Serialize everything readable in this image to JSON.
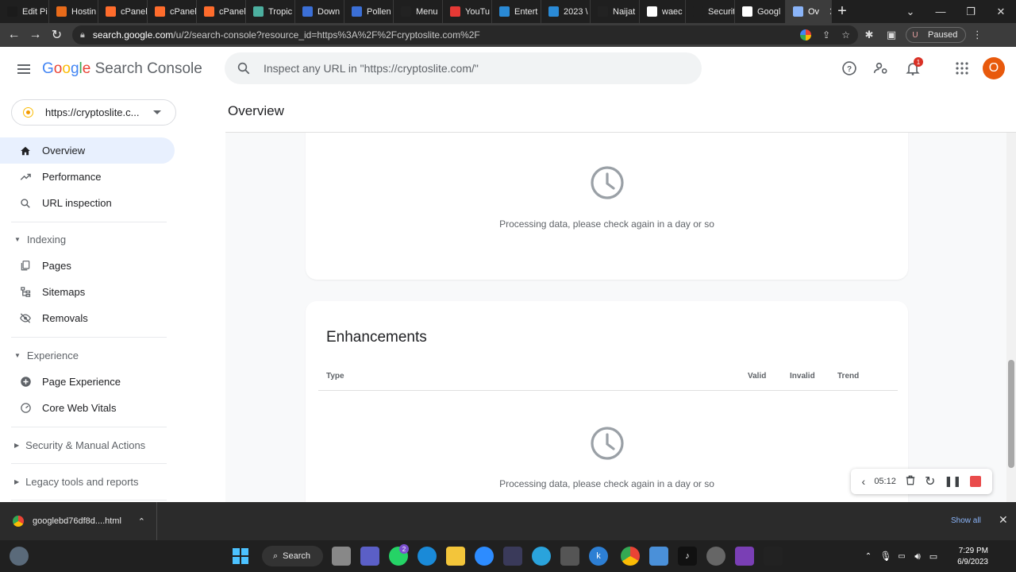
{
  "browser": {
    "tabs": [
      {
        "label": "Edit Pi",
        "icon": "wordpress-icon",
        "color": "#1b1b1b"
      },
      {
        "label": "Hostin",
        "icon": "hosting-icon",
        "color": "#e86b1a"
      },
      {
        "label": "cPanel",
        "icon": "cpanel-icon",
        "color": "#ff6c2c"
      },
      {
        "label": "cPanel",
        "icon": "cpanel-icon",
        "color": "#ff6c2c"
      },
      {
        "label": "cPanel",
        "icon": "cpanel-icon",
        "color": "#ff6c2c"
      },
      {
        "label": "Tropic",
        "icon": "tropic-icon",
        "color": "#4caf9f"
      },
      {
        "label": "Down",
        "icon": "download-site-icon",
        "color": "#3b6fd6"
      },
      {
        "label": "Pollen",
        "icon": "pollen-icon",
        "color": "#3b6fd6"
      },
      {
        "label": "Menu",
        "icon": "menu-site-icon",
        "color": "#222"
      },
      {
        "label": "YouTu",
        "icon": "youtube-download-icon",
        "color": "#e53935"
      },
      {
        "label": "Entert",
        "icon": "entertainment-icon",
        "color": "#2a8ad6"
      },
      {
        "label": "2023 \\",
        "icon": "news-icon",
        "color": "#2a8ad6"
      },
      {
        "label": "Naijat",
        "icon": "naija-icon",
        "color": "#222"
      },
      {
        "label": "waec",
        "icon": "google-icon",
        "color": "#fff"
      },
      {
        "label": "Security er",
        "icon": "blank-icon",
        "color": "#1f1f1f"
      },
      {
        "label": "Googl",
        "icon": "google-icon",
        "color": "#fff"
      },
      {
        "label": "Ov",
        "icon": "search-console-icon",
        "color": "#8ab4f8",
        "active": true
      }
    ],
    "url_host": "search.google.com",
    "url_path": "/u/2/search-console?resource_id=https%3A%2F%2Fcryptoslite.com%2F",
    "profile_initial": "U",
    "profile_status": "Paused"
  },
  "app": {
    "logo_google": "Google",
    "logo_product": "Search Console",
    "search_placeholder": "Inspect any URL in \"https://cryptoslite.com/\"",
    "notification_count": "1",
    "avatar_initial": "O",
    "property": "https://cryptoslite.c..."
  },
  "sidebar": {
    "overview": "Overview",
    "performance": "Performance",
    "url_inspection": "URL inspection",
    "indexing": "Indexing",
    "pages": "Pages",
    "sitemaps": "Sitemaps",
    "removals": "Removals",
    "experience": "Experience",
    "page_experience": "Page Experience",
    "core_web_vitals": "Core Web Vitals",
    "security": "Security & Manual Actions",
    "legacy": "Legacy tools and reports"
  },
  "main": {
    "title": "Overview",
    "processing_text_1": "Processing data, please check again in a day or so",
    "enhancements_title": "Enhancements",
    "col_type": "Type",
    "col_valid": "Valid",
    "col_invalid": "Invalid",
    "col_trend": "Trend",
    "processing_text_2": "Processing data, please check again in a day or so"
  },
  "recorder": {
    "time": "05:12"
  },
  "download": {
    "filename": "googlebd76df8d....html",
    "show_all": "Show all"
  },
  "taskbar": {
    "search_label": "Search",
    "whatsapp_badge": "2",
    "time": "7:29 PM",
    "date": "6/9/2023"
  }
}
